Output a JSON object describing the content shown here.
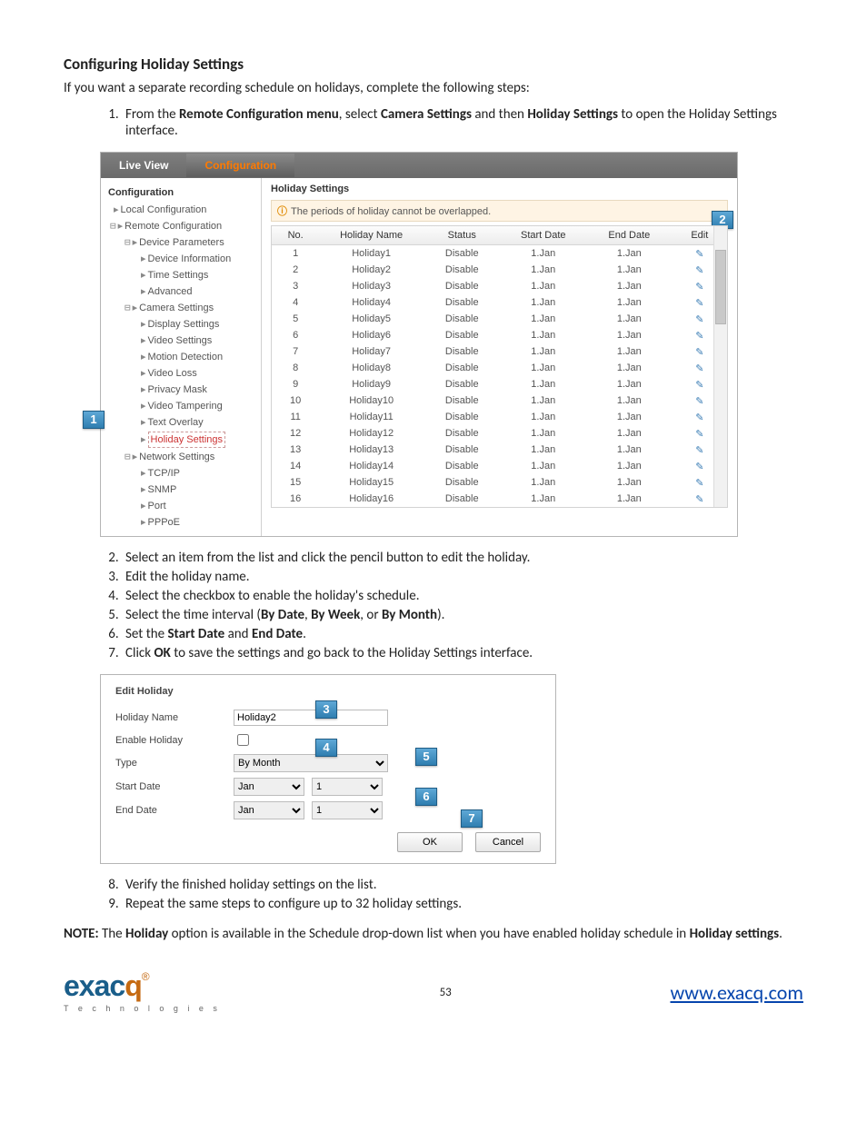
{
  "heading": "Configuring Holiday Settings",
  "intro": "If you want a  separate recording schedule on holidays, complete the following steps:",
  "step1_a": "From the ",
  "step1_b": "Remote Configuration menu",
  "step1_c": ", select ",
  "step1_d": "Camera Settings",
  "step1_e": " and then ",
  "step1_f": "Holiday Settings",
  "step1_g": " to open the Holiday Settings interface.",
  "tabs": {
    "live": "Live View",
    "config": "Configuration"
  },
  "sidebar": {
    "hdr": "Configuration",
    "local": "Local Configuration",
    "remote": "Remote Configuration",
    "devparam": "Device Parameters",
    "devinfo": "Device Information",
    "time": "Time Settings",
    "advanced": "Advanced",
    "cam": "Camera Settings",
    "disp": "Display Settings",
    "vids": "Video Settings",
    "motion": "Motion Detection",
    "vloss": "Video Loss",
    "pmask": "Privacy Mask",
    "vtamp": "Video Tampering",
    "toverlay": "Text Overlay",
    "holset": "Holiday Settings",
    "net": "Network Settings",
    "tcpip": "TCP/IP",
    "snmp": "SNMP",
    "port": "Port",
    "pppoe": "PPPoE"
  },
  "content": {
    "title": "Holiday Settings",
    "note": "The periods of holiday cannot be overlapped.",
    "cols": {
      "no": "No.",
      "name": "Holiday Name",
      "status": "Status",
      "start": "Start Date",
      "end": "End Date",
      "edit": "Edit"
    }
  },
  "rows": [
    {
      "no": "1",
      "name": "Holiday1",
      "status": "Disable",
      "start": "1.Jan",
      "end": "1.Jan"
    },
    {
      "no": "2",
      "name": "Holiday2",
      "status": "Disable",
      "start": "1.Jan",
      "end": "1.Jan"
    },
    {
      "no": "3",
      "name": "Holiday3",
      "status": "Disable",
      "start": "1.Jan",
      "end": "1.Jan"
    },
    {
      "no": "4",
      "name": "Holiday4",
      "status": "Disable",
      "start": "1.Jan",
      "end": "1.Jan"
    },
    {
      "no": "5",
      "name": "Holiday5",
      "status": "Disable",
      "start": "1.Jan",
      "end": "1.Jan"
    },
    {
      "no": "6",
      "name": "Holiday6",
      "status": "Disable",
      "start": "1.Jan",
      "end": "1.Jan"
    },
    {
      "no": "7",
      "name": "Holiday7",
      "status": "Disable",
      "start": "1.Jan",
      "end": "1.Jan"
    },
    {
      "no": "8",
      "name": "Holiday8",
      "status": "Disable",
      "start": "1.Jan",
      "end": "1.Jan"
    },
    {
      "no": "9",
      "name": "Holiday9",
      "status": "Disable",
      "start": "1.Jan",
      "end": "1.Jan"
    },
    {
      "no": "10",
      "name": "Holiday10",
      "status": "Disable",
      "start": "1.Jan",
      "end": "1.Jan"
    },
    {
      "no": "11",
      "name": "Holiday11",
      "status": "Disable",
      "start": "1.Jan",
      "end": "1.Jan"
    },
    {
      "no": "12",
      "name": "Holiday12",
      "status": "Disable",
      "start": "1.Jan",
      "end": "1.Jan"
    },
    {
      "no": "13",
      "name": "Holiday13",
      "status": "Disable",
      "start": "1.Jan",
      "end": "1.Jan"
    },
    {
      "no": "14",
      "name": "Holiday14",
      "status": "Disable",
      "start": "1.Jan",
      "end": "1.Jan"
    },
    {
      "no": "15",
      "name": "Holiday15",
      "status": "Disable",
      "start": "1.Jan",
      "end": "1.Jan"
    },
    {
      "no": "16",
      "name": "Holiday16",
      "status": "Disable",
      "start": "1.Jan",
      "end": "1.Jan"
    }
  ],
  "callouts": {
    "c1": "1",
    "c2": "2",
    "c3": "3",
    "c4": "4",
    "c5": "5",
    "c6": "6",
    "c7": "7"
  },
  "step2": "Select an item from the list and click the pencil button to edit the holiday.",
  "step3": "Edit the holiday name.",
  "step4": "Select the checkbox to enable the holiday's schedule.",
  "step5_a": "Select the time interval (",
  "step5_b": "By Date",
  "step5_c": ", ",
  "step5_d": "By Week",
  "step5_e": ", or ",
  "step5_f": "By Month",
  "step5_g": ").",
  "step6_a": "Set the ",
  "step6_b": "Start Date",
  "step6_c": " and ",
  "step6_d": "End Date",
  "step6_e": ".",
  "step7_a": "Click ",
  "step7_b": "OK",
  "step7_c": " to save the settings and go back to the Holiday Settings interface.",
  "edit": {
    "title": "Edit Holiday",
    "name_lbl": "Holiday Name",
    "name_val": "Holiday2",
    "enable_lbl": "Enable Holiday",
    "type_lbl": "Type",
    "type_val": "By Month",
    "start_lbl": "Start Date",
    "start_m": "Jan",
    "start_d": "1",
    "end_lbl": "End Date",
    "end_m": "Jan",
    "end_d": "1",
    "ok": "OK",
    "cancel": "Cancel"
  },
  "step8": "Verify the finished holiday settings on the list.",
  "step9": "Repeat the same steps to configure up to 32 holiday settings.",
  "note2_a": "NOTE:",
  "note2_b": " The ",
  "note2_c": "Holiday",
  "note2_d": " option is available in the Schedule drop-down list when you have enabled holiday schedule in ",
  "note2_e": "Holiday settings",
  "note2_f": ".",
  "footer": {
    "logo_big": "exac",
    "logo_sub": "T e c h n o l o g i e s",
    "page": "53",
    "url": "www.exacq.com"
  }
}
